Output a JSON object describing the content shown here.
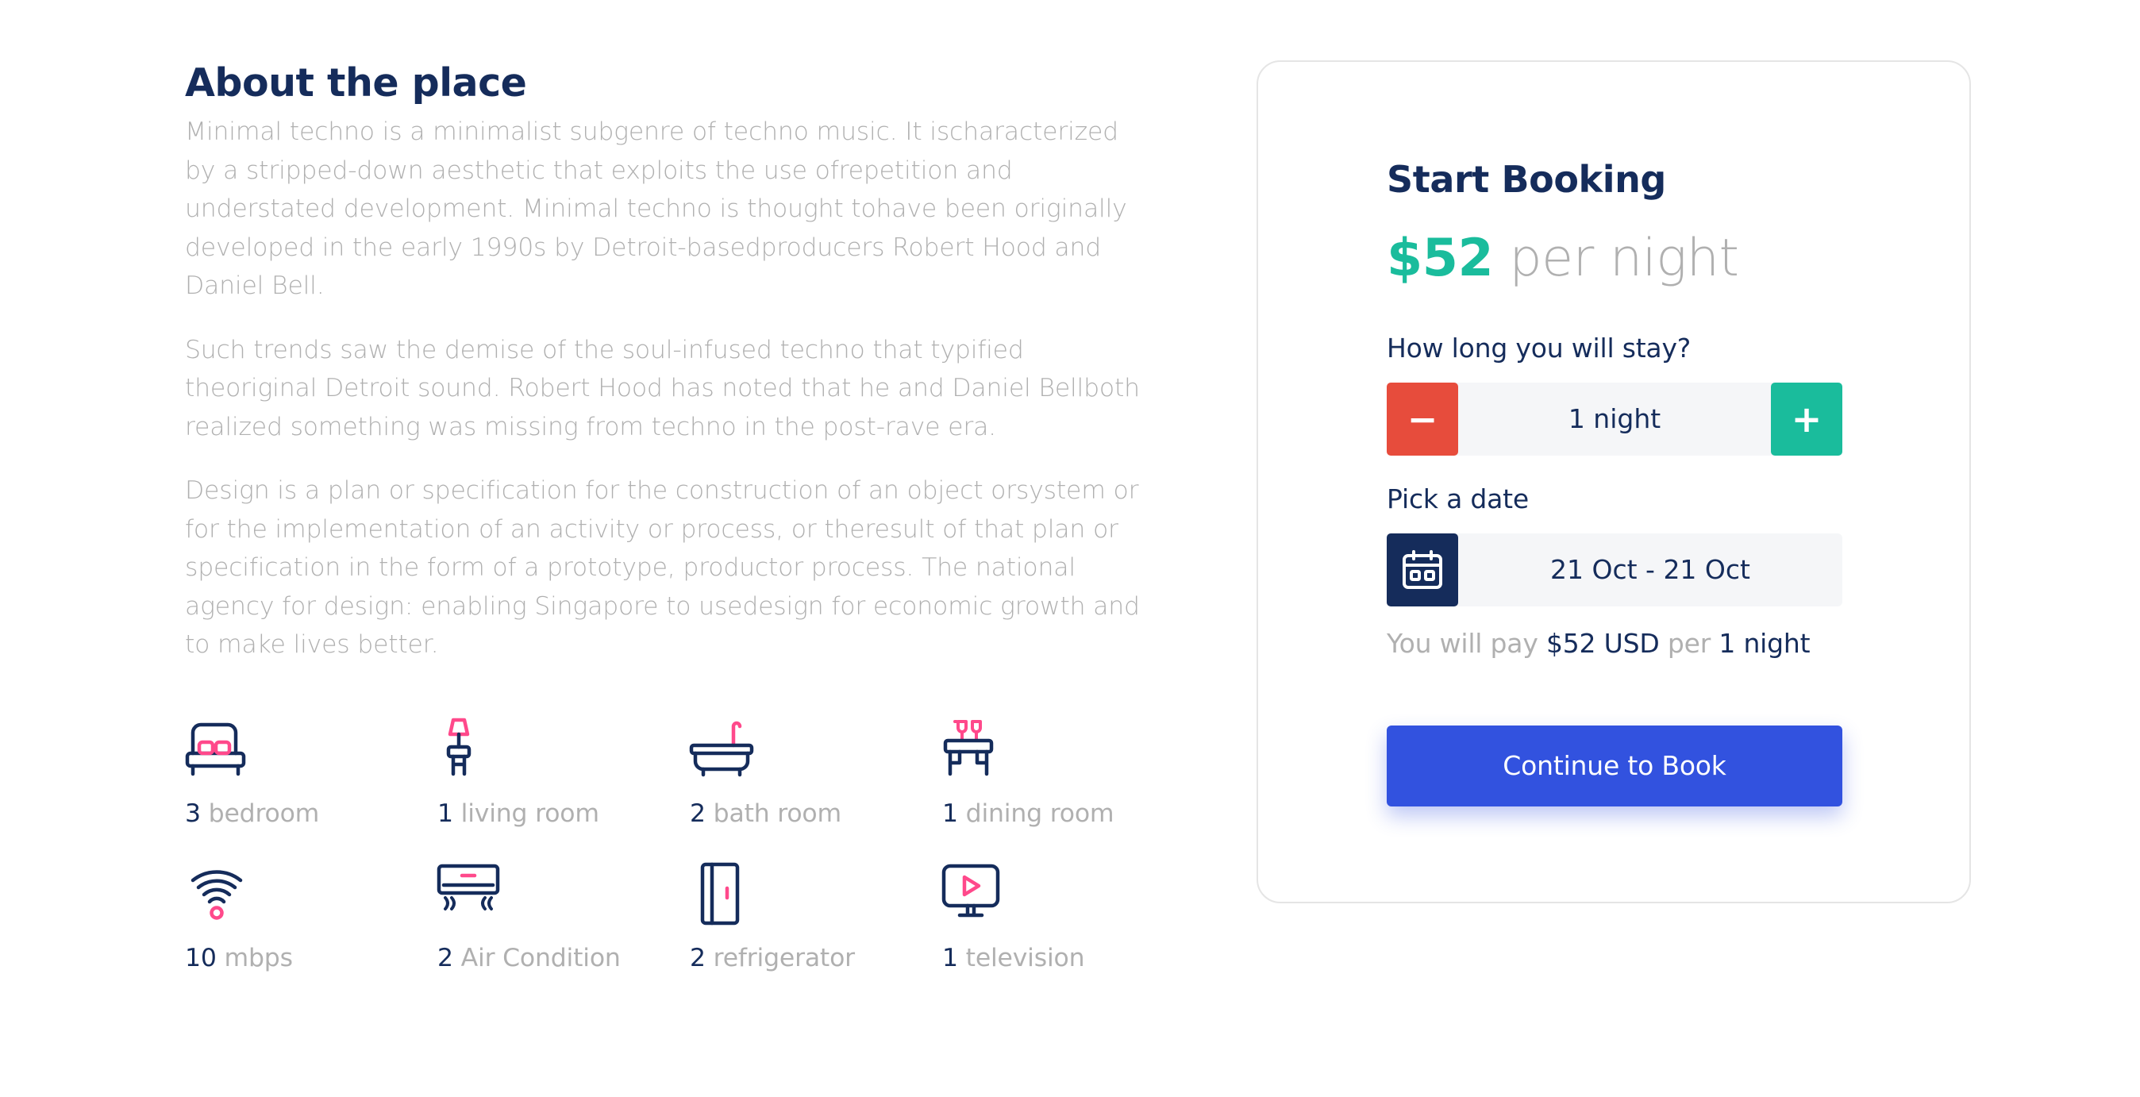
{
  "about": {
    "title": "About the place",
    "paragraphs": [
      "Minimal techno is a minimalist subgenre of techno music. It ischaracterized by a stripped-down aesthetic that exploits the use ofrepetition and understated development. Minimal techno is thought tohave been originally developed in the early 1990s by Detroit-basedproducers Robert Hood and Daniel Bell.",
      "Such trends saw the demise of the soul-infused techno that typified theoriginal Detroit sound. Robert Hood has noted that he and Daniel Bellboth realized something was missing from techno in the post-rave era.",
      "Design is a plan or specification for the construction of an object orsystem or for the implementation of an activity or process, or theresult of that plan or specification in the form of a prototype, productor process. The national agency for design: enabling Singapore to usedesign for economic growth and to make lives better."
    ]
  },
  "amenities": [
    {
      "icon": "bed-icon",
      "count": "3",
      "label": "bedroom"
    },
    {
      "icon": "lamp-icon",
      "count": "1",
      "label": "living room"
    },
    {
      "icon": "bathtub-icon",
      "count": "2",
      "label": "bath room"
    },
    {
      "icon": "dining-table-icon",
      "count": "1",
      "label": "dining room"
    },
    {
      "icon": "wifi-icon",
      "count": "10",
      "label": "mbps"
    },
    {
      "icon": "air-conditioner-icon",
      "count": "2",
      "label": "Air Condition"
    },
    {
      "icon": "refrigerator-icon",
      "count": "2",
      "label": "refrigerator"
    },
    {
      "icon": "television-icon",
      "count": "1",
      "label": "television"
    }
  ],
  "booking": {
    "title": "Start Booking",
    "price_amount": "$52",
    "price_unit": "per night",
    "duration_label": "How long you will stay?",
    "minus_label": "−",
    "duration_value": "1 night",
    "plus_label": "+",
    "date_label": "Pick a date",
    "date_value": "21 Oct - 21 Oct",
    "summary_prefix": "You will pay",
    "summary_amount": "$52 USD",
    "summary_mid": "per",
    "summary_nights": "1 night",
    "cta_label": "Continue to Book"
  },
  "colors": {
    "primary_navy": "#152c5b",
    "muted_gray": "#b0b0b0",
    "accent_green": "#1abc9c",
    "danger_red": "#e74c3c",
    "accent_pink": "#ff498b",
    "cta_blue": "#3252df",
    "field_bg": "#f5f6f8"
  }
}
